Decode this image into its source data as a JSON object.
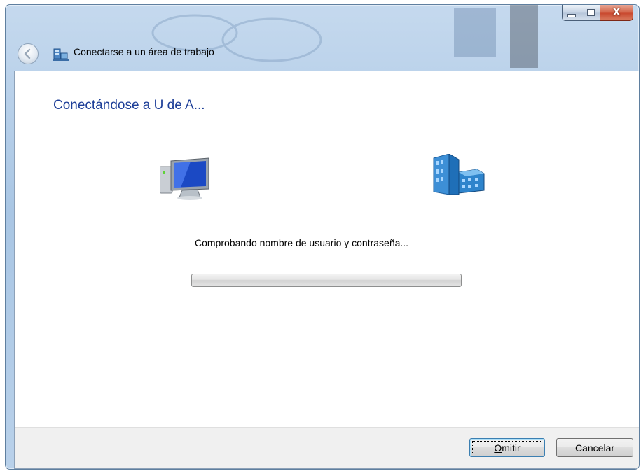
{
  "window": {
    "title": "Conectarse a un área de trabajo",
    "close_glyph": "X"
  },
  "icons": {
    "back": "back-arrow-icon",
    "app": "network-workplace-icon",
    "computer": "computer-icon",
    "building": "office-building-icon"
  },
  "main": {
    "heading": "Conectándose a U de A...",
    "status": "Comprobando nombre de usuario y contraseña...",
    "progress": 0
  },
  "buttons": {
    "skip_mnemonic": "O",
    "skip_rest": "mitir",
    "cancel": "Cancelar"
  },
  "colors": {
    "heading": "#1e3f98",
    "close_button": "#c7432a"
  }
}
